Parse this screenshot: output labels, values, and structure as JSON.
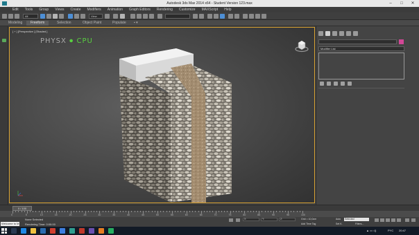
{
  "window": {
    "title": "Autodesk 3ds Max  2014 x64    - Student Version    123.max"
  },
  "menu": [
    "Edit",
    "Tools",
    "Group",
    "Views",
    "Create",
    "Modifiers",
    "Animation",
    "Graph Editors",
    "Rendering",
    "Customize",
    "MAXScript",
    "Help"
  ],
  "toolbar": {
    "selection_filter": "All",
    "view_dropdown": "View"
  },
  "ribbon": {
    "tabs": [
      "Modeling",
      "Freeform",
      "Selection",
      "Object Paint",
      "Populate"
    ],
    "active_tab": "Freeform"
  },
  "viewport": {
    "label": "[ + ] [Perspective ] [Shaded ]",
    "physx_text": "PHYSX",
    "physx_mode": "CPU"
  },
  "command_panel": {
    "modifier_list": "Modifier List",
    "swatch_color": "#d24796"
  },
  "time_slider": {
    "frame_readout": "0 / 100",
    "ticks": [
      "0",
      "5",
      "10",
      "15",
      "20",
      "25",
      "30",
      "35",
      "40",
      "45",
      "50",
      "55",
      "60",
      "65",
      "70",
      "75",
      "80",
      "85",
      "90",
      "95",
      "100"
    ]
  },
  "status": {
    "maxscript": "Welcome to M",
    "selection": "None Selected",
    "prompt": "Rendering Time: 0:00:00",
    "grid": "Grid = 10,0cm",
    "add_time_tag": "Add Time Tag",
    "auto_key": "Auto",
    "set_key": "Set K.",
    "key_filter_selected": "Selected",
    "key_filters": "Filters..."
  },
  "taskbar": {
    "language": "PYC",
    "clock": "20:47"
  }
}
